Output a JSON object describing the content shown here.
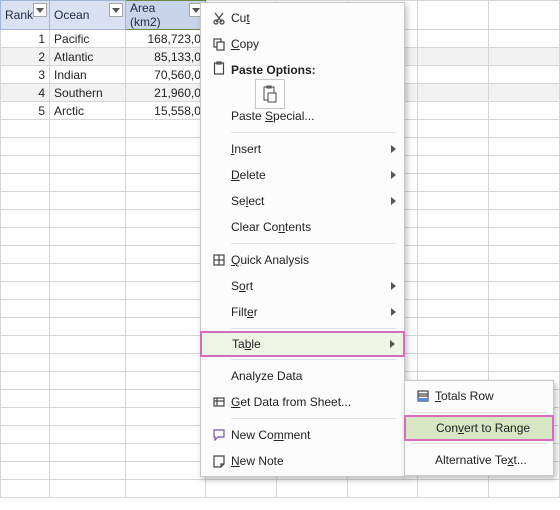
{
  "table": {
    "headers": [
      "Rank",
      "Ocean",
      "Area (km2)"
    ],
    "rows": [
      {
        "rank": "1",
        "ocean": "Pacific",
        "area": "168,723,0"
      },
      {
        "rank": "2",
        "ocean": "Atlantic",
        "area": "85,133,0"
      },
      {
        "rank": "3",
        "ocean": "Indian",
        "area": "70,560,0"
      },
      {
        "rank": "4",
        "ocean": "Southern",
        "area": "21,960,0"
      },
      {
        "rank": "5",
        "ocean": "Arctic",
        "area": "15,558,0"
      }
    ]
  },
  "menu": {
    "cut": "Cut",
    "copy": "Copy",
    "paste_options": "Paste Options:",
    "paste_special": "Paste Special...",
    "insert": "Insert",
    "delete": "Delete",
    "select": "Select",
    "clear_contents": "Clear Contents",
    "quick_analysis": "Quick Analysis",
    "sort": "Sort",
    "filter": "Filter",
    "table": "Table",
    "analyze_data": "Analyze Data",
    "get_data": "Get Data from Sheet...",
    "new_comment": "New Comment",
    "new_note": "New Note"
  },
  "submenu": {
    "totals_row": "Totals Row",
    "convert_to_range": "Convert to Range",
    "alternative_text": "Alternative Text..."
  }
}
